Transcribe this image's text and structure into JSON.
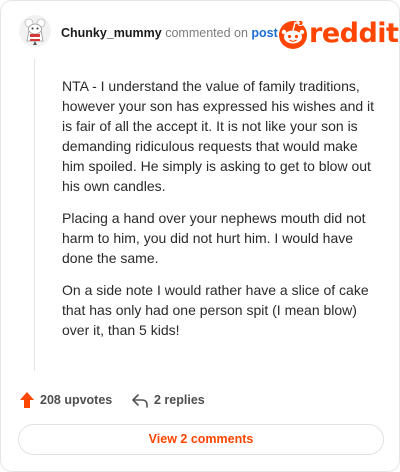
{
  "header": {
    "username": "Chunky_mummy",
    "action_text": "commented on",
    "post_link": "post",
    "logo_text": "reddit",
    "brand_color": "#ff4500",
    "link_color": "#1c6ed6"
  },
  "comment": {
    "paragraphs": [
      "NTA - I understand the value of family traditions, however your son has expressed his wishes and it is fair of all the accept it. It is not like your son is demanding ridiculous requests that would make him spoiled. He simply is asking to get to blow out his own candles.",
      "Placing a hand over your nephews mouth did not harm to him, you did not hurt him. I would have done the same.",
      "On a side note I would rather have a slice of cake that has only had one person spit (I mean blow) over it, than 5 kids!"
    ]
  },
  "footer": {
    "upvotes_label": "208 upvotes",
    "replies_label": "2 replies",
    "view_comments_label": "View 2 comments"
  },
  "icons": {
    "avatar": "avatar-icon",
    "logo": "reddit-logo-icon",
    "upvote": "upvote-arrow-icon",
    "reply": "reply-arrow-icon"
  }
}
